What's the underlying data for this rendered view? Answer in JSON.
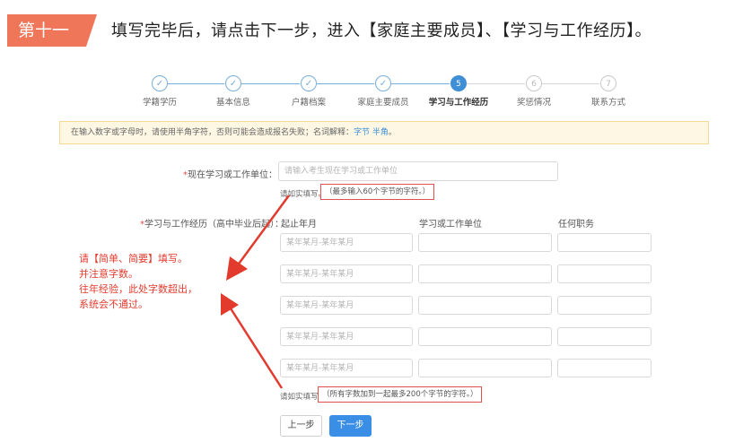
{
  "header": {
    "step_tag": "第十一",
    "instruction": "填写完毕后，请点击下一步，进入【家庭主要成员】、【学习与工作经历】。"
  },
  "progress": {
    "steps": [
      {
        "label": "学籍学历",
        "mark": "✓"
      },
      {
        "label": "基本信息",
        "mark": "✓"
      },
      {
        "label": "户籍档案",
        "mark": "✓"
      },
      {
        "label": "家庭主要成员",
        "mark": "✓"
      },
      {
        "label": "学习与工作经历",
        "mark": "5"
      },
      {
        "label": "奖惩情况",
        "mark": "6"
      },
      {
        "label": "联系方式",
        "mark": "7"
      }
    ]
  },
  "notice": {
    "text": "在输入数字或字母时，请使用半角字符，否则可能会造成报名失败；名词解释：",
    "link1": "字节",
    "link2": "半角",
    "end": "。"
  },
  "current_unit": {
    "required_mark": "*",
    "label": "现在学习或工作单位：",
    "placeholder": "请输入考生现在学习或工作单位",
    "hint_prefix": "请如实填写。",
    "hint_boxed": "（最多输入60个字节的字符。）"
  },
  "history": {
    "required_mark": "*",
    "label": "学习与工作经历（高中毕业后起）：",
    "columns": {
      "period": "起止年月",
      "unit": "学习或工作单位",
      "position": "任何职务"
    },
    "period_placeholder": "某年某月-某年某月",
    "rows": 5,
    "hint_prefix": "请如实填写。",
    "hint_boxed": "（所有字数加到一起最多200个字节的字符。）"
  },
  "annotation": {
    "line1": "请【简单、简要】填写。",
    "line2": "并注意字数。",
    "line3": "往年经验，此处字数超出，",
    "line4": "系统会不通过。"
  },
  "buttons": {
    "prev": "上一步",
    "next": "下一步"
  },
  "colors": {
    "accent": "#3e8fd6",
    "tag": "#f0765a",
    "annotation": "#e23b2e"
  }
}
